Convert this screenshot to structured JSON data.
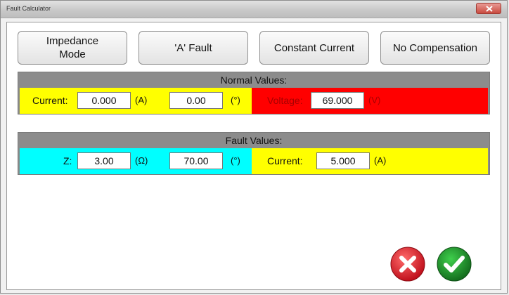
{
  "window": {
    "title": "Fault Calculator"
  },
  "mode_buttons": {
    "impedance_mode": "Impedance\nMode",
    "fault_type": "'A' Fault",
    "constant_current": "Constant Current",
    "compensation": "No Compensation"
  },
  "normal_values": {
    "header": "Normal Values:",
    "current_label": "Current:",
    "current_value": "0.000",
    "current_unit": "(A)",
    "angle_value": "0.00",
    "angle_unit": "(°)",
    "voltage_label": "Voltage:",
    "voltage_value": "69.000",
    "voltage_unit": "(V)"
  },
  "fault_values": {
    "header": "Fault Values:",
    "z_label": "Z:",
    "z_value": "3.00",
    "z_unit": "(Ω)",
    "angle_value": "70.00",
    "angle_unit": "(°)",
    "current_label": "Current:",
    "current_value": "5.000",
    "current_unit": "(A)"
  },
  "colors": {
    "yellow": "#ffff00",
    "red": "#ff0000",
    "cyan": "#00ffff",
    "cancel": "#e0202a",
    "ok": "#1f9a2c"
  },
  "icons": {
    "cancel": "cancel-x-icon",
    "ok": "ok-check-icon"
  }
}
